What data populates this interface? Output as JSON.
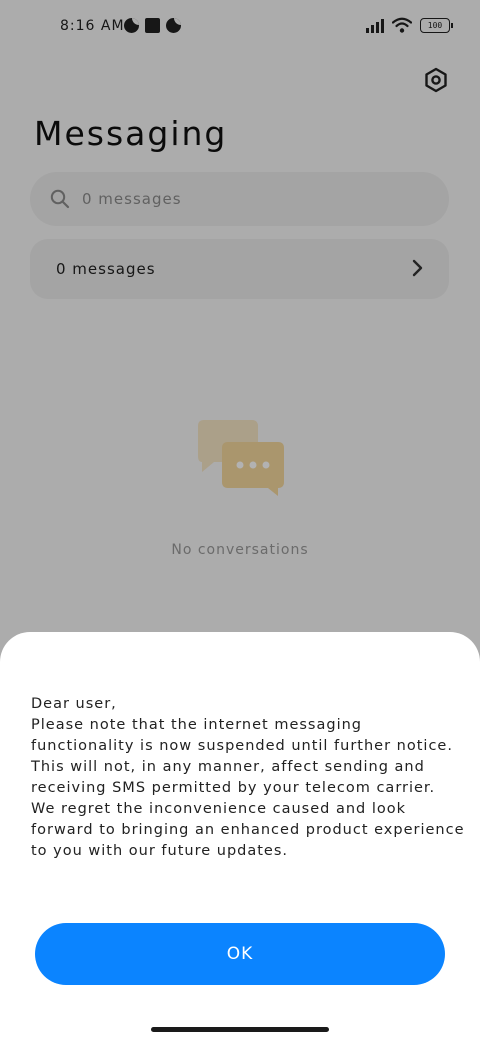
{
  "status_bar": {
    "time": "8:16 AM",
    "battery": "100"
  },
  "header": {
    "title": "Messaging"
  },
  "search": {
    "placeholder": "0 messages"
  },
  "messages_row": {
    "label": "0 messages"
  },
  "empty_state": {
    "text": "No conversations"
  },
  "dialog": {
    "lines": [
      "Dear user,",
      "Please note that the internet messaging",
      "functionality is now suspended until further notice.",
      "This will not, in any manner, affect sending and",
      "receiving SMS permitted by your telecom carrier.",
      "We regret the inconvenience caused and look",
      "forward to bringing an enhanced product experience",
      "to you with our future updates."
    ],
    "ok_label": "OK"
  },
  "colors": {
    "accent": "#0b84ff",
    "illustration": "#f4d79c"
  }
}
